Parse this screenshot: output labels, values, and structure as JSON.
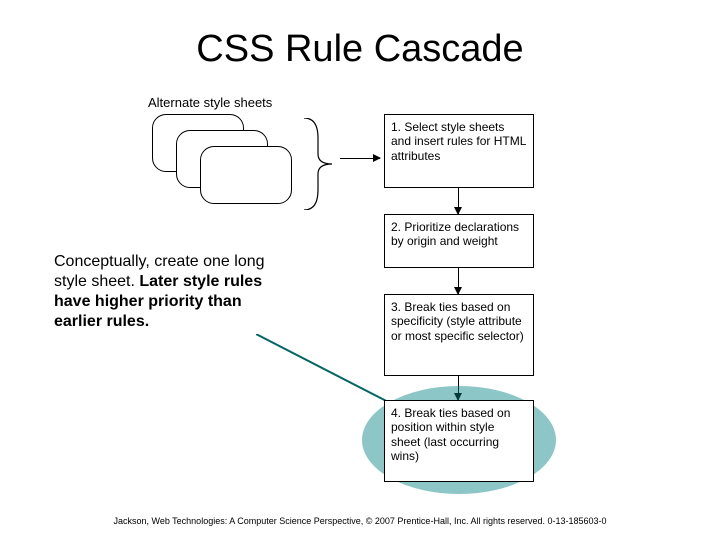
{
  "title": "CSS Rule Cascade",
  "alt_label": "Alternate style sheets",
  "steps": {
    "s1": "1. Select style sheets and insert rules for HTML attributes",
    "s2": "2. Prioritize declarations by origin and weight",
    "s3": "3. Break ties based on specificity (style attribute or most specific selector)",
    "s4": "4. Break ties based on position within style sheet (last occurring wins)"
  },
  "para": {
    "lead": "Conceptually, create one long style sheet. ",
    "bold": "Later style rules have higher priority than earlier rules."
  },
  "footer": "Jackson, Web Technologies: A Computer Science Perspective, © 2007 Prentice-Hall, Inc. All rights reserved. 0-13-185603-0"
}
